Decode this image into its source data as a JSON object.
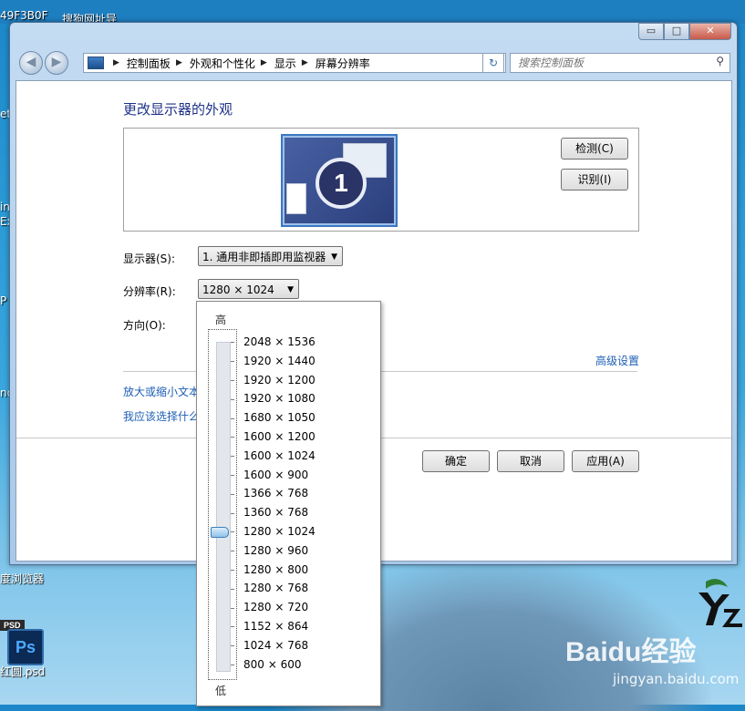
{
  "desktop": {
    "top_texts": [
      "49F3B0F",
      "搜狗网址导"
    ],
    "side_labels": [
      "et",
      "in",
      "Ex",
      "P",
      "nc",
      "度浏览器",
      "红圆.psd"
    ],
    "ps_badge": "PSD",
    "ps_icon": "Ps",
    "watermark": "Baidu经验",
    "watermark_url": "jingyan.baidu.com"
  },
  "window": {
    "caption_buttons": [
      "▭",
      "□",
      "✕"
    ],
    "breadcrumb": [
      "控制面板",
      "外观和个性化",
      "显示",
      "屏幕分辨率"
    ],
    "search_placeholder": "搜索控制面板"
  },
  "main": {
    "title": "更改显示器的外观",
    "monitor_number": "1",
    "detect_button": "检测(C)",
    "identify_button": "识别(I)",
    "display_label": "显示器(S):",
    "display_value": "1. 通用非即插即用监视器",
    "resolution_label": "分辨率(R):",
    "resolution_value": "1280 × 1024",
    "orientation_label": "方向(O):",
    "advanced_link": "高级设置",
    "link_text_size": "放大或缩小文本",
    "link_help": "我应该选择什么",
    "ok_button": "确定",
    "cancel_button": "取消",
    "apply_button": "应用(A)"
  },
  "dropdown": {
    "high_label": "高",
    "low_label": "低",
    "selected_index": 10,
    "resolutions": [
      "2048 × 1536",
      "1920 × 1440",
      "1920 × 1200",
      "1920 × 1080",
      "1680 × 1050",
      "1600 × 1200",
      "1600 × 1024",
      "1600 × 900",
      "1366 × 768",
      "1360 × 768",
      "1280 × 1024",
      "1280 × 960",
      "1280 × 800",
      "1280 × 768",
      "1280 × 720",
      "1152 × 864",
      "1024 × 768",
      "800 × 600"
    ]
  }
}
